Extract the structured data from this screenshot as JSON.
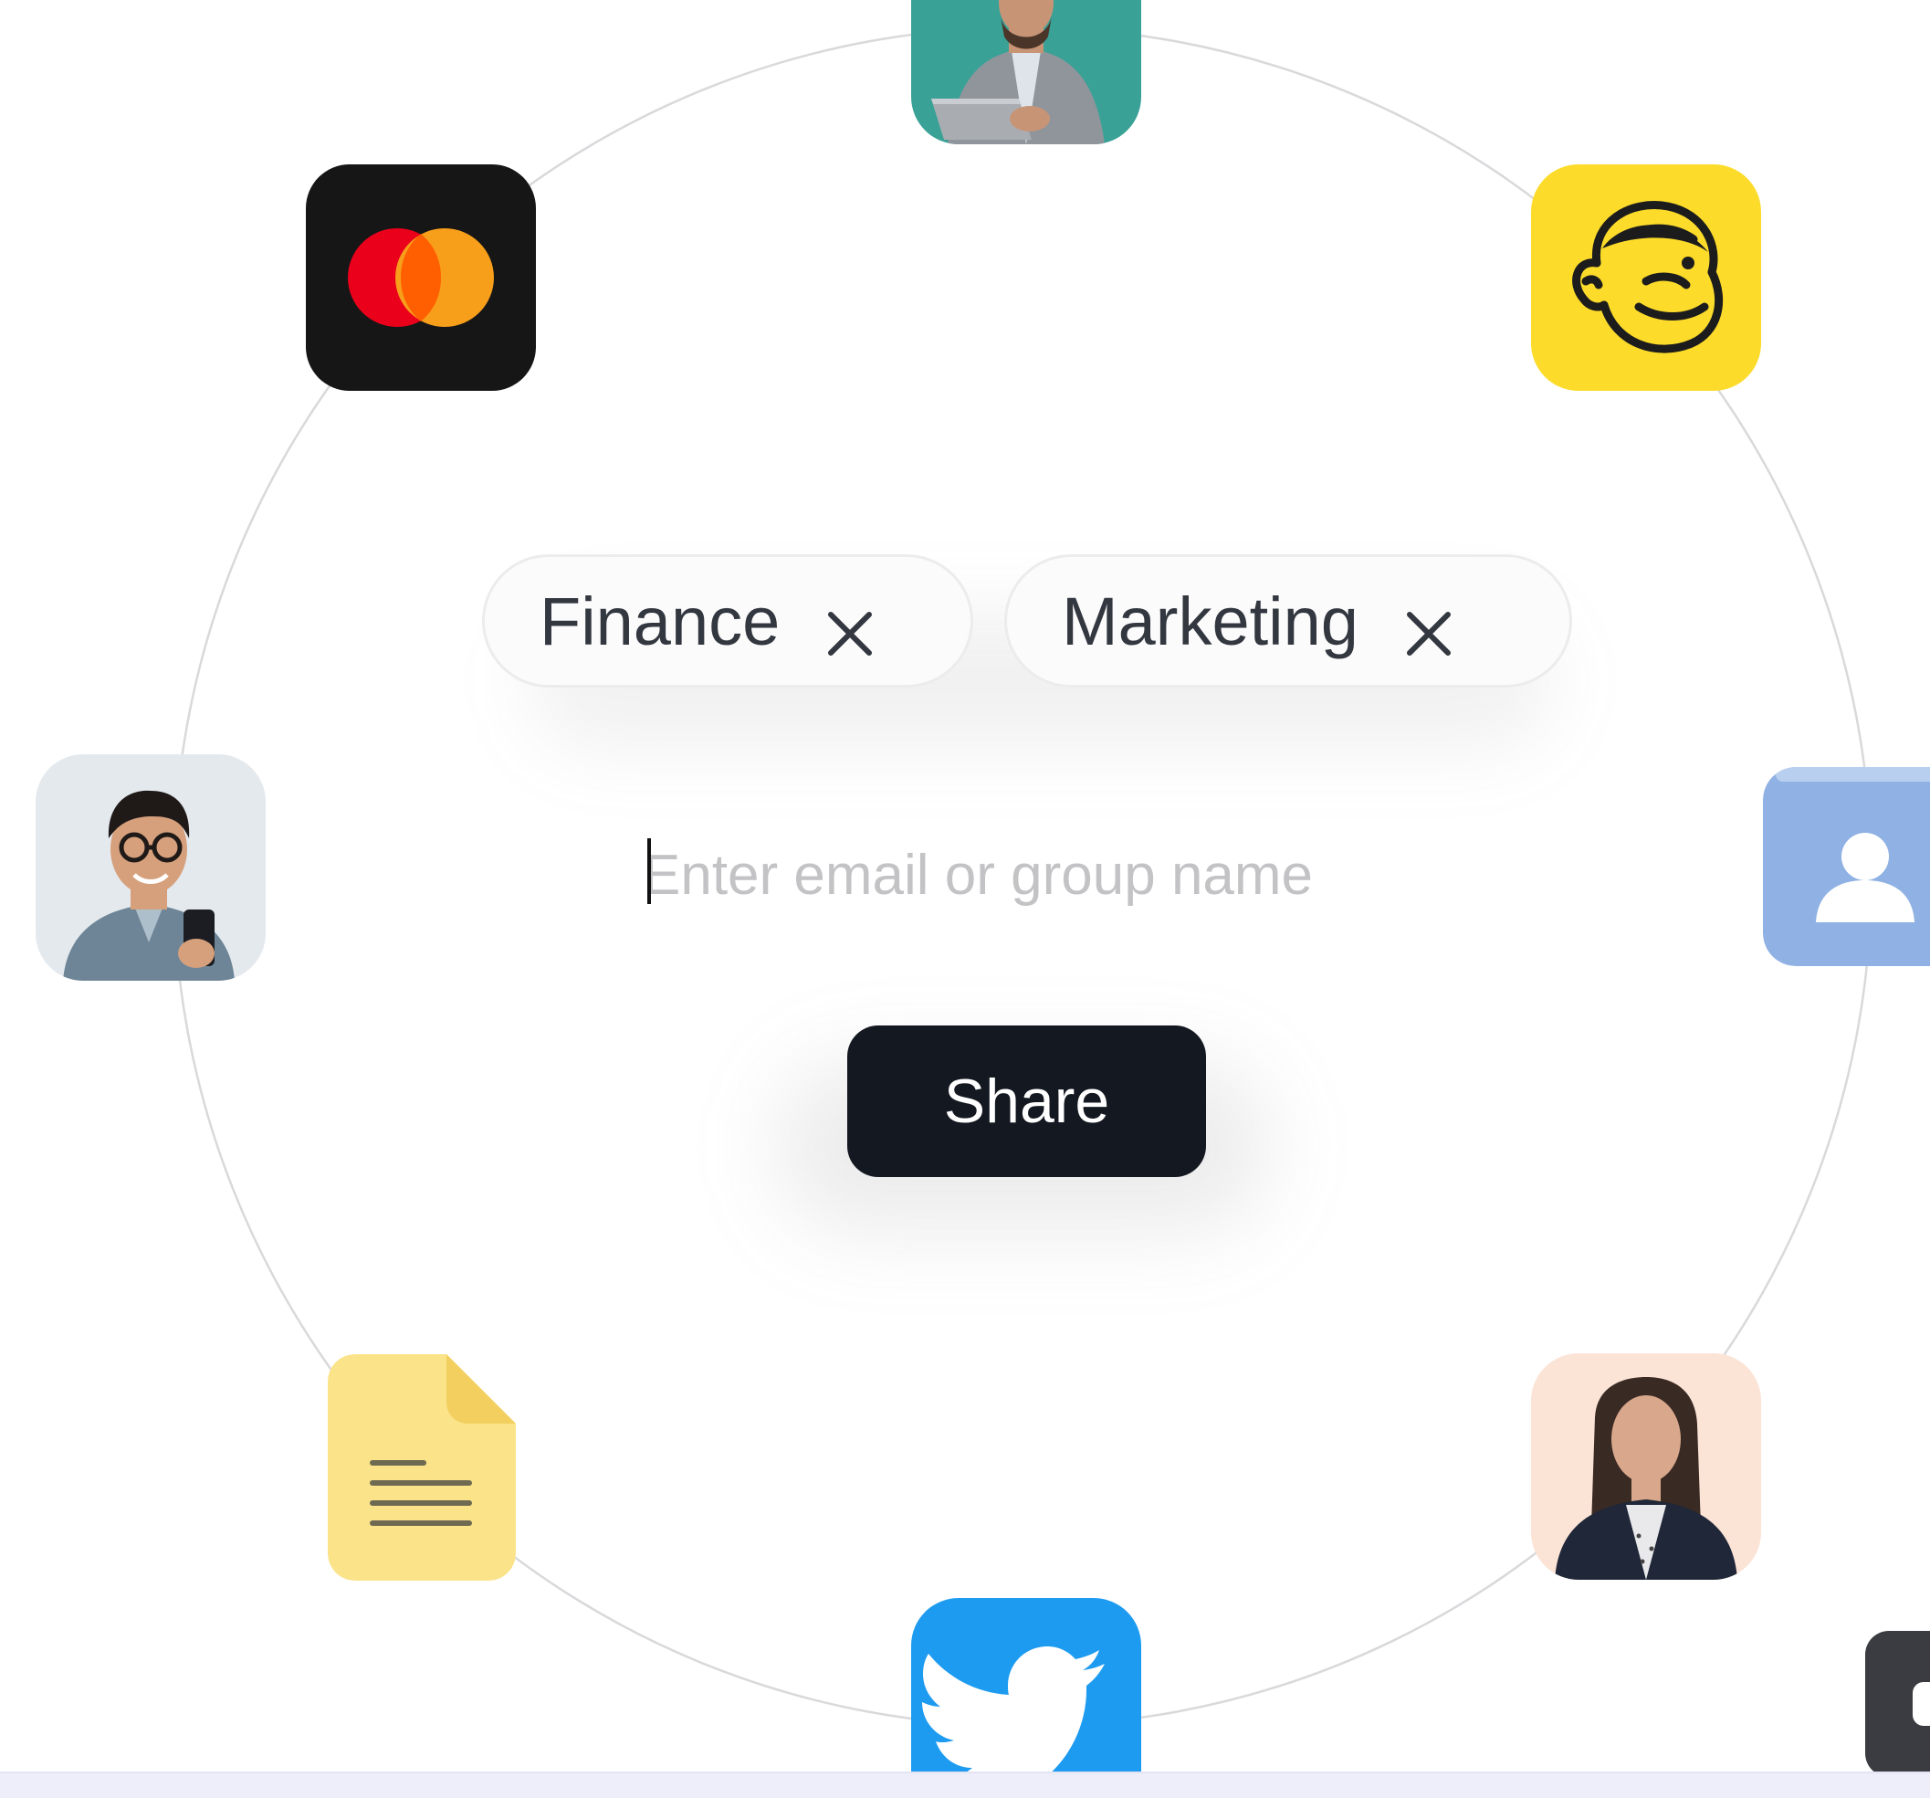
{
  "tags": [
    {
      "label": "Finance",
      "remove_icon": "close-icon"
    },
    {
      "label": "Marketing",
      "remove_icon": "close-icon"
    }
  ],
  "recipient_input": {
    "value": "",
    "placeholder": "Enter email or group name"
  },
  "share_button": {
    "label": "Share"
  },
  "orbit_icons": [
    "person-with-laptop-avatar",
    "mailchimp-icon",
    "contacts-icon",
    "woman-in-blazer-avatar",
    "twitter-icon",
    "document-icon",
    "man-with-phone-avatar",
    "mastercard-icon",
    "dark-app-icon"
  ],
  "colors": {
    "button_bg": "#141821",
    "button_text": "#ffffff",
    "chip_border": "#ececec",
    "chip_text": "#333740",
    "placeholder": "#c3c3c6",
    "orbit_ring": "#d9d9dc",
    "mailchimp_yellow": "#FCDB2A",
    "twitter_blue": "#1D9BF0",
    "mastercard_red": "#EB001B",
    "mastercard_orange": "#F79E1B",
    "contacts_blue": "#8FB1E3",
    "document_yellow": "#FBE38A"
  }
}
